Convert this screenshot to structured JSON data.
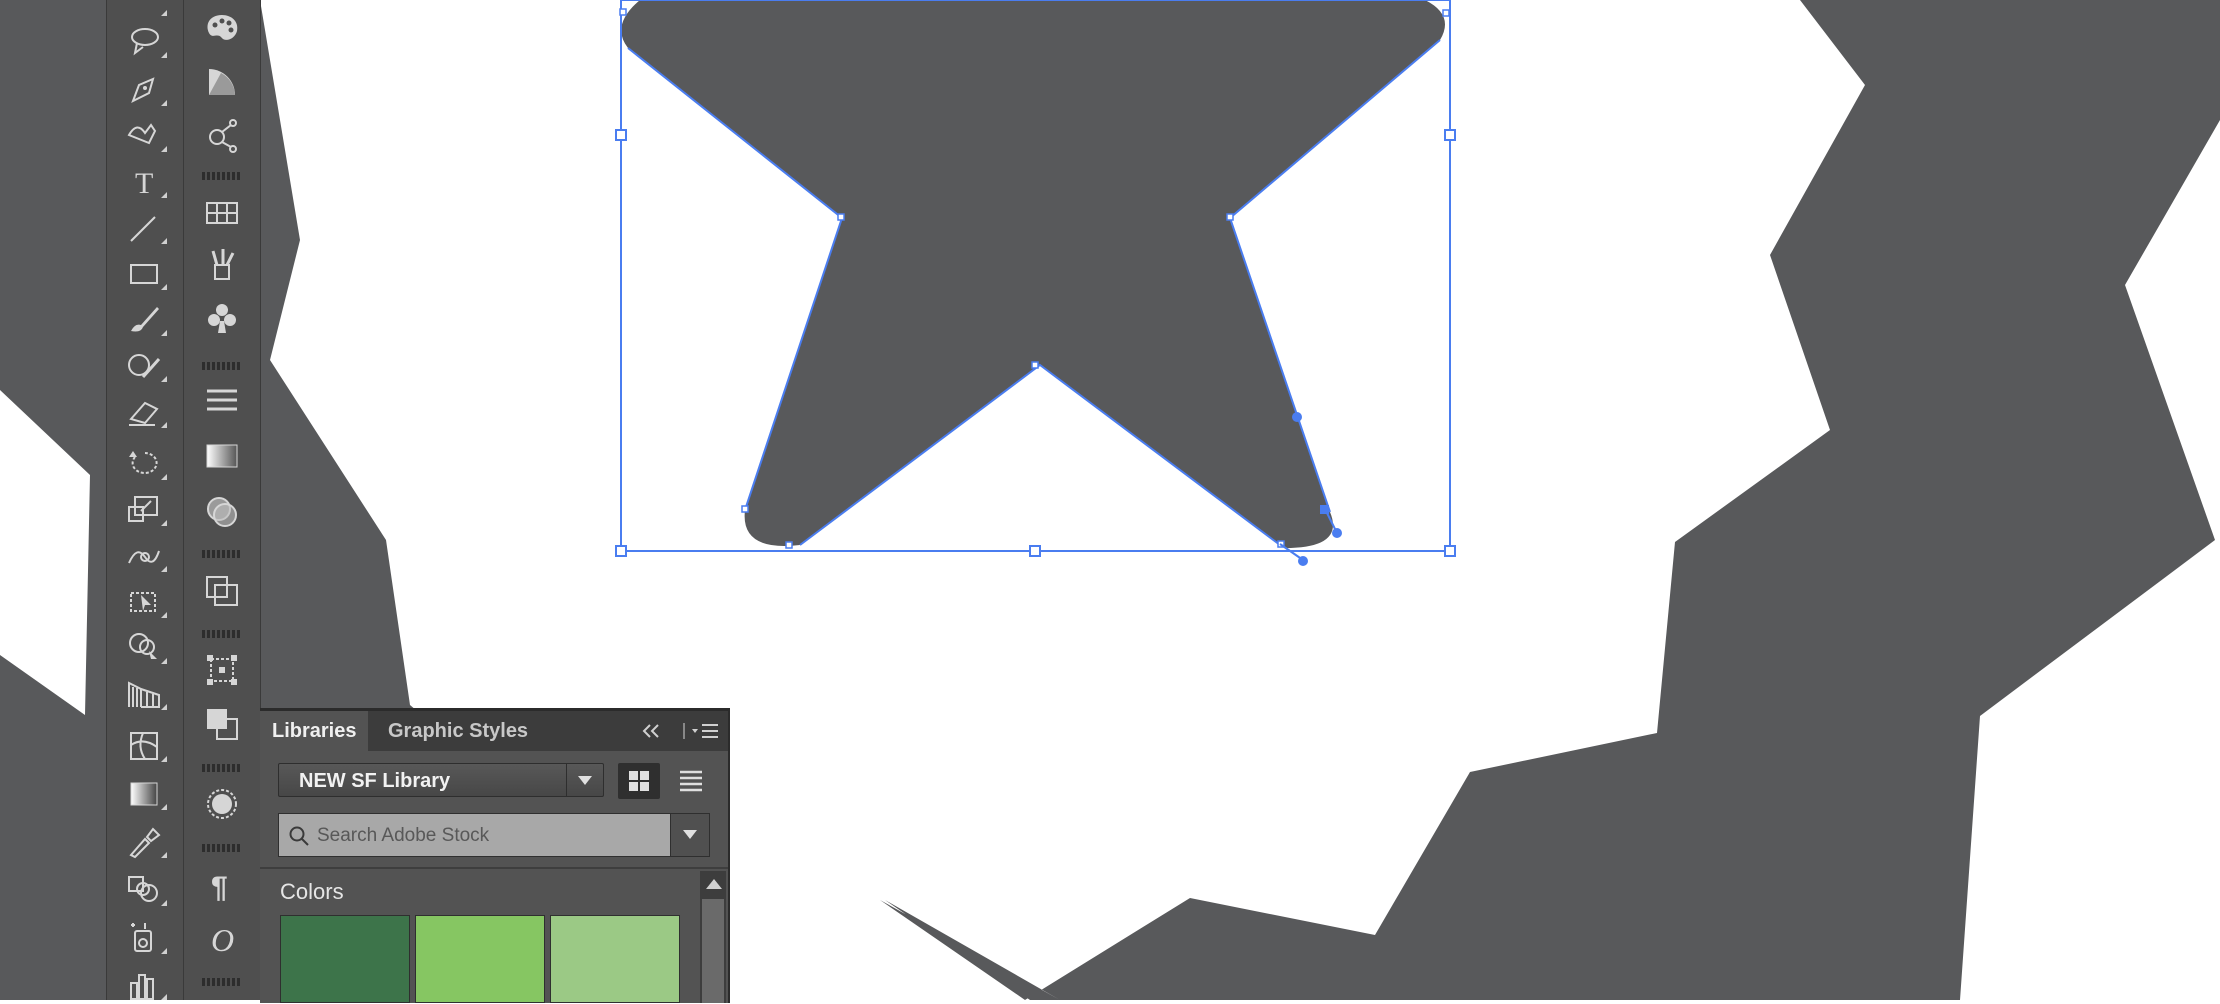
{
  "panel": {
    "tabs": [
      "Libraries",
      "Graphic Styles"
    ],
    "library_name": "NEW SF Library",
    "search_placeholder": "Search Adobe Stock",
    "colors_label": "Colors",
    "swatches": [
      "#3d744a",
      "#86c662",
      "#9bc985"
    ]
  },
  "colors": {
    "shape_fill": "#58595b",
    "selection": "#4a7df0",
    "panel_bg": "#535353",
    "toolbar_bg": "#4f4f4f"
  },
  "tools_left": [
    "lasso-icon",
    "pen-icon",
    "curvature-icon",
    "type-icon",
    "line-icon",
    "rectangle-icon",
    "paintbrush-icon",
    "shaper-icon",
    "eraser-icon",
    "rotate-icon",
    "scale-icon",
    "warp-icon",
    "free-transform-icon",
    "shape-builder-icon",
    "perspective-grid-icon",
    "mesh-icon",
    "gradient-icon",
    "eyedropper-icon",
    "blend-icon",
    "symbol-sprayer-icon",
    "column-graph-icon"
  ],
  "tools_right": [
    "color-palette-icon",
    "color-guide-icon",
    "cc-libraries-icon",
    "swatches-icon",
    "brushes-icon",
    "symbols-icon",
    "stroke-icon",
    "gradient-panel-icon",
    "transparency-icon",
    "appearance-icon",
    "transform-icon",
    "align-icon",
    "pathfinder-icon",
    "paragraph-icon",
    "opentype-icon"
  ]
}
